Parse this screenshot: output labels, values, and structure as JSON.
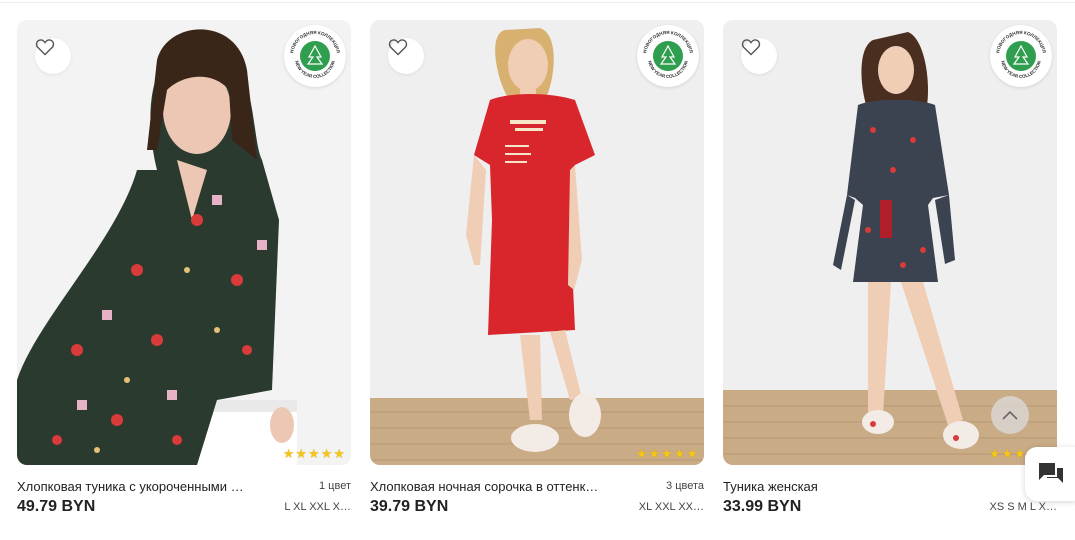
{
  "badge": {
    "text_top": "НОВОГОДНЯЯ КОЛЛЕКЦИЯ",
    "text_bottom": "NEW YEAR COLLECTION",
    "color": "#2f9e4f"
  },
  "products": [
    {
      "title": "Хлопковая туника с укороченными …",
      "colors": "1 цвет",
      "price": "49.79 BYN",
      "sizes": "L XL XXL X…",
      "rating_stars": 5,
      "garment_color": "#2b3a2f"
    },
    {
      "title": "Хлопковая ночная сорочка в оттенк…",
      "colors": "3 цвета",
      "price": "39.79 BYN",
      "sizes": "XL XXL XX…",
      "rating_stars": 5,
      "garment_color": "#d9262c"
    },
    {
      "title": "Туника женская",
      "colors": "",
      "price": "33.99 BYN",
      "sizes": "XS S M L X…",
      "rating_stars": 5,
      "garment_color": "#3b4250"
    }
  ],
  "icons": {
    "favorite": "heart-outline-icon",
    "scroll_top": "chevron-up-icon",
    "chat": "chat-bubbles-icon",
    "star": "star-icon"
  }
}
